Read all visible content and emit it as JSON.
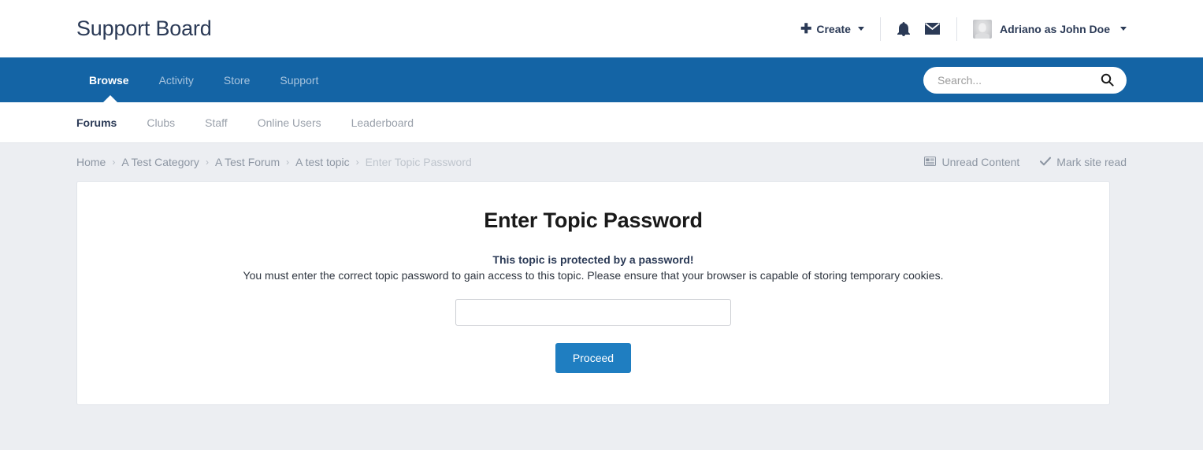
{
  "header": {
    "site_title": "Support Board",
    "create_label": "Create",
    "create_icon": "plus-icon",
    "notifications_icon": "bell-icon",
    "messages_icon": "envelope-icon",
    "user_name": "Adriano as John Doe",
    "avatar_icon": "user-avatar"
  },
  "primary_nav": {
    "items": [
      {
        "label": "Browse",
        "active": true
      },
      {
        "label": "Activity",
        "active": false
      },
      {
        "label": "Store",
        "active": false
      },
      {
        "label": "Support",
        "active": false
      }
    ],
    "search": {
      "placeholder": "Search...",
      "value": "",
      "icon": "search-icon"
    }
  },
  "secondary_nav": {
    "items": [
      {
        "label": "Forums",
        "active": true
      },
      {
        "label": "Clubs",
        "active": false
      },
      {
        "label": "Staff",
        "active": false
      },
      {
        "label": "Online Users",
        "active": false
      },
      {
        "label": "Leaderboard",
        "active": false
      }
    ]
  },
  "breadcrumb": {
    "separator": "›",
    "items": [
      {
        "label": "Home",
        "current": false
      },
      {
        "label": "A Test Category",
        "current": false
      },
      {
        "label": "A Test Forum",
        "current": false
      },
      {
        "label": "A test topic",
        "current": false
      },
      {
        "label": "Enter Topic Password",
        "current": true
      }
    ],
    "actions": [
      {
        "label": "Unread Content",
        "icon": "newspaper-icon"
      },
      {
        "label": "Mark site read",
        "icon": "check-icon"
      }
    ]
  },
  "main": {
    "title": "Enter Topic Password",
    "lead": "This topic is protected by a password!",
    "description": "You must enter the correct topic password to gain access to this topic. Please ensure that your browser is capable of storing temporary cookies.",
    "password_value": "",
    "password_placeholder": "",
    "submit_label": "Proceed"
  },
  "colors": {
    "nav_blue": "#1464a5",
    "button_blue": "#1f7ec1",
    "page_bg": "#eceef2",
    "text_navy": "#2b3a56"
  }
}
